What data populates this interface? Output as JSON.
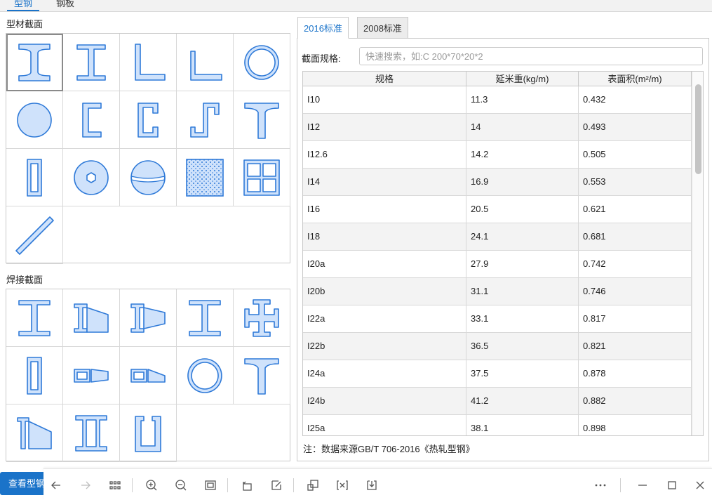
{
  "top_tabs": [
    {
      "label": "型钢",
      "active": true
    },
    {
      "label": "钢板",
      "active": false
    }
  ],
  "sections": {
    "profile_title": "型材截面",
    "welded_title": "焊接截面"
  },
  "standard_tabs": [
    {
      "label": "2016标准",
      "active": true
    },
    {
      "label": "2008标准",
      "active": false
    }
  ],
  "search": {
    "label": "截面规格:",
    "placeholder": "快速搜索，如:C 200*70*20*2",
    "value": ""
  },
  "table": {
    "headers": [
      "规格",
      "延米重(kg/m)",
      "表面积(m²/m)"
    ],
    "rows": [
      [
        "I10",
        "11.3",
        "0.432"
      ],
      [
        "I12",
        "14",
        "0.493"
      ],
      [
        "I12.6",
        "14.2",
        "0.505"
      ],
      [
        "I14",
        "16.9",
        "0.553"
      ],
      [
        "I16",
        "20.5",
        "0.621"
      ],
      [
        "I18",
        "24.1",
        "0.681"
      ],
      [
        "I20a",
        "27.9",
        "0.742"
      ],
      [
        "I20b",
        "31.1",
        "0.746"
      ],
      [
        "I22a",
        "33.1",
        "0.817"
      ],
      [
        "I22b",
        "36.5",
        "0.821"
      ],
      [
        "I24a",
        "37.5",
        "0.878"
      ],
      [
        "I24b",
        "41.2",
        "0.882"
      ],
      [
        "I25a",
        "38.1",
        "0.898"
      ]
    ]
  },
  "note": "注：数据来源GB/T 706-2016《热轧型钢》",
  "bottom_button": "查看型钢",
  "toolbar_icons": [
    "back-icon",
    "forward-icon",
    "grid-icon",
    "zoom-in-icon",
    "zoom-out-icon",
    "fit-screen-icon",
    "rotate-icon",
    "edit-icon",
    "screenshot-icon",
    "formula-icon",
    "save-icon",
    "more-icon",
    "minimize-icon",
    "maximize-icon",
    "close-icon"
  ],
  "colors": {
    "accent": "#1a73c9",
    "shape_fill": "#cfe2fb",
    "shape_stroke": "#2f7ad8"
  }
}
